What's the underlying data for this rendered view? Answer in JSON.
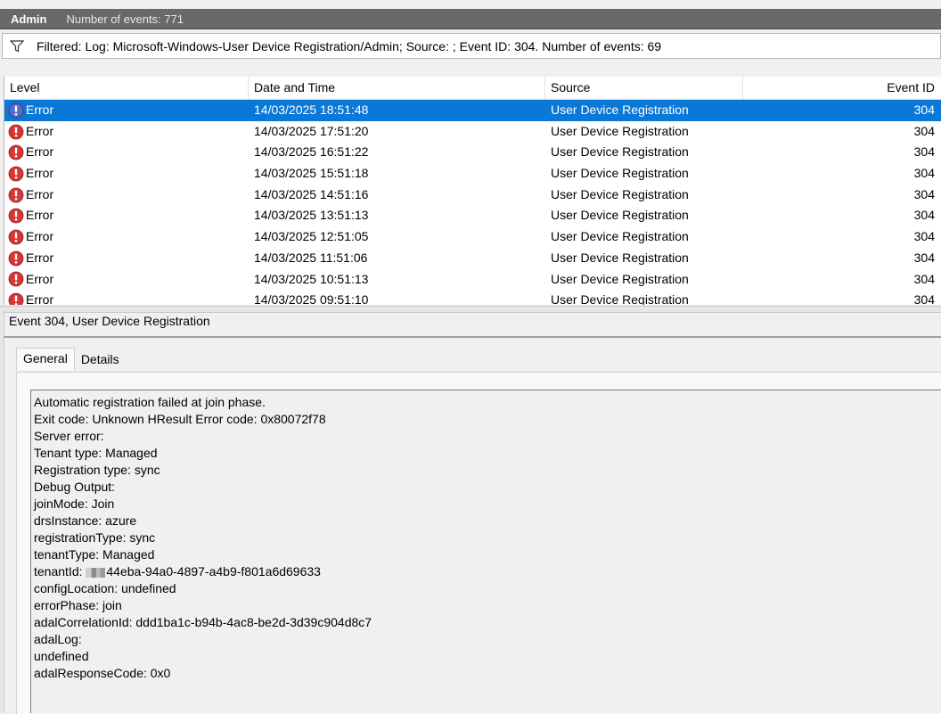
{
  "log_header": {
    "name": "Admin",
    "count_text": "Number of events: 771"
  },
  "filter": {
    "text": "Filtered: Log: Microsoft-Windows-User Device Registration/Admin; Source: ; Event ID: 304. Number of events: 69"
  },
  "columns": [
    "Level",
    "Date and Time",
    "Source",
    "Event ID"
  ],
  "rows": [
    {
      "level": "Error",
      "datetime": "14/03/2025 18:51:48",
      "source": "User Device Registration",
      "event_id": "304",
      "selected": true
    },
    {
      "level": "Error",
      "datetime": "14/03/2025 17:51:20",
      "source": "User Device Registration",
      "event_id": "304"
    },
    {
      "level": "Error",
      "datetime": "14/03/2025 16:51:22",
      "source": "User Device Registration",
      "event_id": "304"
    },
    {
      "level": "Error",
      "datetime": "14/03/2025 15:51:18",
      "source": "User Device Registration",
      "event_id": "304"
    },
    {
      "level": "Error",
      "datetime": "14/03/2025 14:51:16",
      "source": "User Device Registration",
      "event_id": "304"
    },
    {
      "level": "Error",
      "datetime": "14/03/2025 13:51:13",
      "source": "User Device Registration",
      "event_id": "304"
    },
    {
      "level": "Error",
      "datetime": "14/03/2025 12:51:05",
      "source": "User Device Registration",
      "event_id": "304"
    },
    {
      "level": "Error",
      "datetime": "14/03/2025 11:51:06",
      "source": "User Device Registration",
      "event_id": "304"
    },
    {
      "level": "Error",
      "datetime": "14/03/2025 10:51:13",
      "source": "User Device Registration",
      "event_id": "304"
    },
    {
      "level": "Error",
      "datetime": "14/03/2025 09:51:10",
      "source": "User Device Registration",
      "event_id": "304"
    }
  ],
  "detail": {
    "title": "Event 304, User Device Registration",
    "tabs": [
      "General",
      "Details"
    ],
    "description_lines": [
      "Automatic registration failed at join phase.",
      "Exit code: Unknown HResult Error code: 0x80072f78",
      "Server error:",
      "Tenant type: Managed",
      "Registration type: sync",
      "Debug Output:",
      "joinMode: Join",
      "drsInstance: azure",
      "registrationType: sync",
      "tenantType: Managed",
      "tenantId: ",
      "configLocation: undefined",
      "errorPhase: join",
      "adalCorrelationId: ddd1ba1c-b94b-4ac8-be2d-3d39c904d8c7",
      "adalLog:",
      "undefined",
      "adalResponseCode: 0x0"
    ],
    "tenant_id_suffix": "44eba-94a0-4897-a4b9-f801a6d69633"
  },
  "colors": {
    "selection": "#0a78d7",
    "error_icon": "#d93535",
    "title_bar": "#696969"
  },
  "icons": {
    "filter": "filter-icon",
    "error": "error-icon"
  }
}
